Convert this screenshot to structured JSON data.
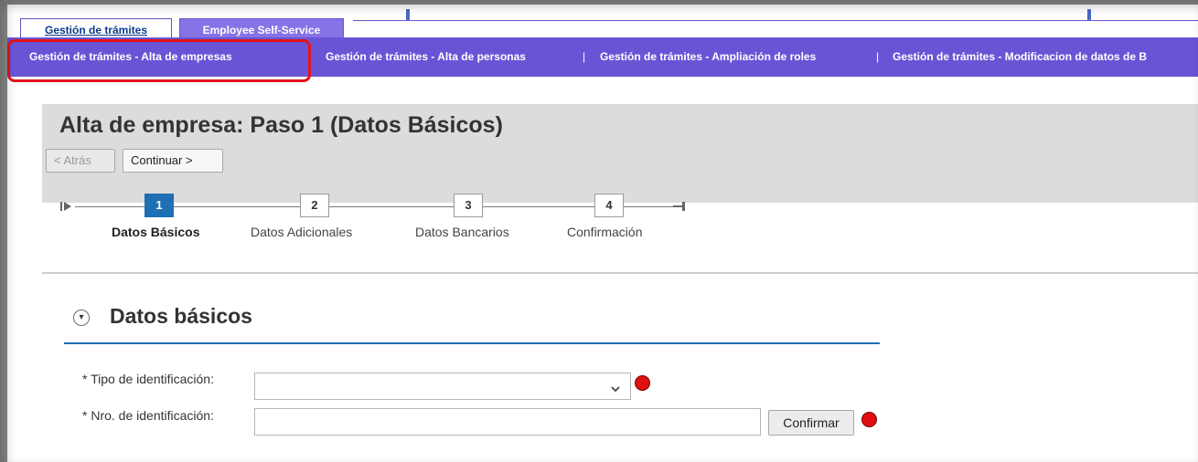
{
  "top_tabs": [
    {
      "label": "Gestión de trámites"
    },
    {
      "label": "Employee Self-Service"
    }
  ],
  "subnav": {
    "items": [
      "Gestión de trámites - Alta de empresas",
      "Gestión de trámites - Alta de personas",
      "Gestión de trámites - Ampliación de roles",
      "Gestión de trámites - Modificacion de datos de B"
    ],
    "separator": "|"
  },
  "header": {
    "title": "Alta de empresa: Paso 1  (Datos Básicos)",
    "back_label": "< Atrás",
    "continue_label": "Continuar >"
  },
  "wizard": {
    "steps": [
      {
        "number": "1",
        "label": "Datos Básicos"
      },
      {
        "number": "2",
        "label": "Datos Adicionales"
      },
      {
        "number": "3",
        "label": "Datos Bancarios"
      },
      {
        "number": "4",
        "label": "Confirmación"
      }
    ]
  },
  "section": {
    "title": "Datos básicos",
    "fields": [
      {
        "label": "* Tipo de identificación:",
        "value": ""
      },
      {
        "label": "* Nro. de identificación:",
        "value": ""
      }
    ],
    "confirm_label": "Confirmar"
  },
  "colors": {
    "nav_purple": "#6a54d6",
    "tab_purple": "#8772e6",
    "accent_blue": "#1e6fb4",
    "highlight_red": "#e3131b",
    "marker_red": "#e01010"
  }
}
